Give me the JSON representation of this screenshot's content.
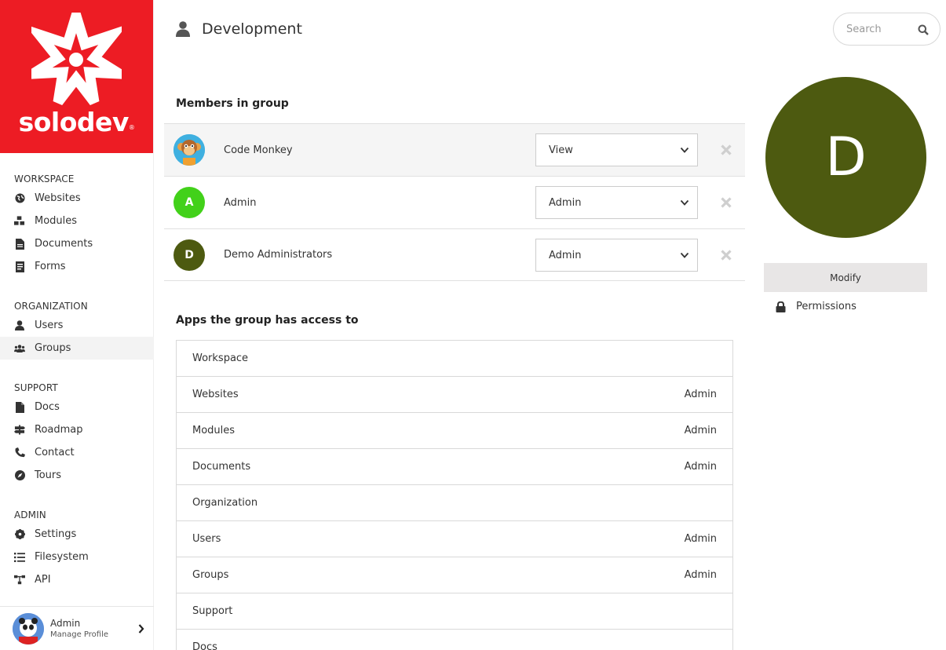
{
  "brand": {
    "name": "solodev",
    "reg": "®",
    "color": "#ed1c24"
  },
  "sidebar": {
    "sections": [
      {
        "heading": "WORKSPACE",
        "items": [
          {
            "label": "Websites",
            "icon": "globe-icon"
          },
          {
            "label": "Modules",
            "icon": "cubes-icon"
          },
          {
            "label": "Documents",
            "icon": "file-icon"
          },
          {
            "label": "Forms",
            "icon": "form-icon"
          }
        ]
      },
      {
        "heading": "ORGANIZATION",
        "items": [
          {
            "label": "Users",
            "icon": "user-icon"
          },
          {
            "label": "Groups",
            "icon": "users-icon",
            "active": true
          }
        ]
      },
      {
        "heading": "SUPPORT",
        "items": [
          {
            "label": "Docs",
            "icon": "doc-icon"
          },
          {
            "label": "Roadmap",
            "icon": "signpost-icon"
          },
          {
            "label": "Contact",
            "icon": "phone-icon"
          },
          {
            "label": "Tours",
            "icon": "compass-icon"
          }
        ]
      },
      {
        "heading": "ADMIN",
        "items": [
          {
            "label": "Settings",
            "icon": "gear-icon"
          },
          {
            "label": "Filesystem",
            "icon": "list-icon"
          },
          {
            "label": "API",
            "icon": "sitemap-icon"
          }
        ]
      }
    ],
    "profile": {
      "name": "Admin",
      "subtitle": "Manage Profile"
    }
  },
  "header": {
    "title": "Development",
    "search_placeholder": "Search"
  },
  "members": {
    "title": "Members in group",
    "rows": [
      {
        "name": "Code Monkey",
        "role": "View",
        "avatar": "",
        "avatar_color": "#3aa8d8",
        "highlight": true
      },
      {
        "name": "Admin",
        "role": "Admin",
        "avatar": "A",
        "avatar_color": "#42d11a"
      },
      {
        "name": "Demo Administrators",
        "role": "Admin",
        "avatar": "D",
        "avatar_color": "#4d5a10"
      }
    ]
  },
  "apps": {
    "title": "Apps the group has access to",
    "rows": [
      {
        "name": "Workspace",
        "permission": ""
      },
      {
        "name": "Websites",
        "permission": "Admin"
      },
      {
        "name": "Modules",
        "permission": "Admin"
      },
      {
        "name": "Documents",
        "permission": "Admin"
      },
      {
        "name": "Organization",
        "permission": ""
      },
      {
        "name": "Users",
        "permission": "Admin"
      },
      {
        "name": "Groups",
        "permission": "Admin"
      },
      {
        "name": "Support",
        "permission": ""
      },
      {
        "name": "Docs",
        "permission": ""
      }
    ]
  },
  "group": {
    "initial": "D",
    "color": "#4d5a10",
    "modify_label": "Modify",
    "permissions_label": "Permissions"
  }
}
